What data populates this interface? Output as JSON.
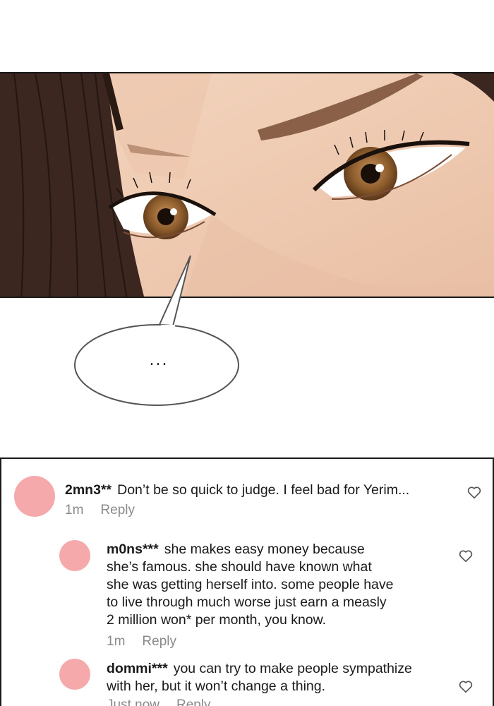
{
  "panel": {
    "speech_bubble": "...",
    "colors": {
      "skin": "#f1cdb2",
      "hair": "#3b2620",
      "iris": "#8a5a2a"
    }
  },
  "comments": [
    {
      "username": "2mn3**",
      "text": "Don’t be so quick to judge. I feel bad for Yerim...",
      "time": "1m",
      "reply": "Reply",
      "icon": "heart-outline-icon"
    },
    {
      "username": "m0ns***",
      "text_lines": [
        "she makes easy money because",
        "she’s famous. she should have known what",
        "she was getting herself into. some people have",
        "to live through much worse just earn a measly",
        "2 million won* per month, you know."
      ],
      "time": "1m",
      "reply": "Reply",
      "icon": "heart-outline-icon"
    },
    {
      "username": "dommi***",
      "text_lines": [
        "you can try to make people sympathize",
        "with her, but it won’t change a thing."
      ],
      "time": "Just now",
      "reply": "Reply",
      "icon": "heart-outline-icon"
    }
  ],
  "avatar_color": "#f6a9ab"
}
